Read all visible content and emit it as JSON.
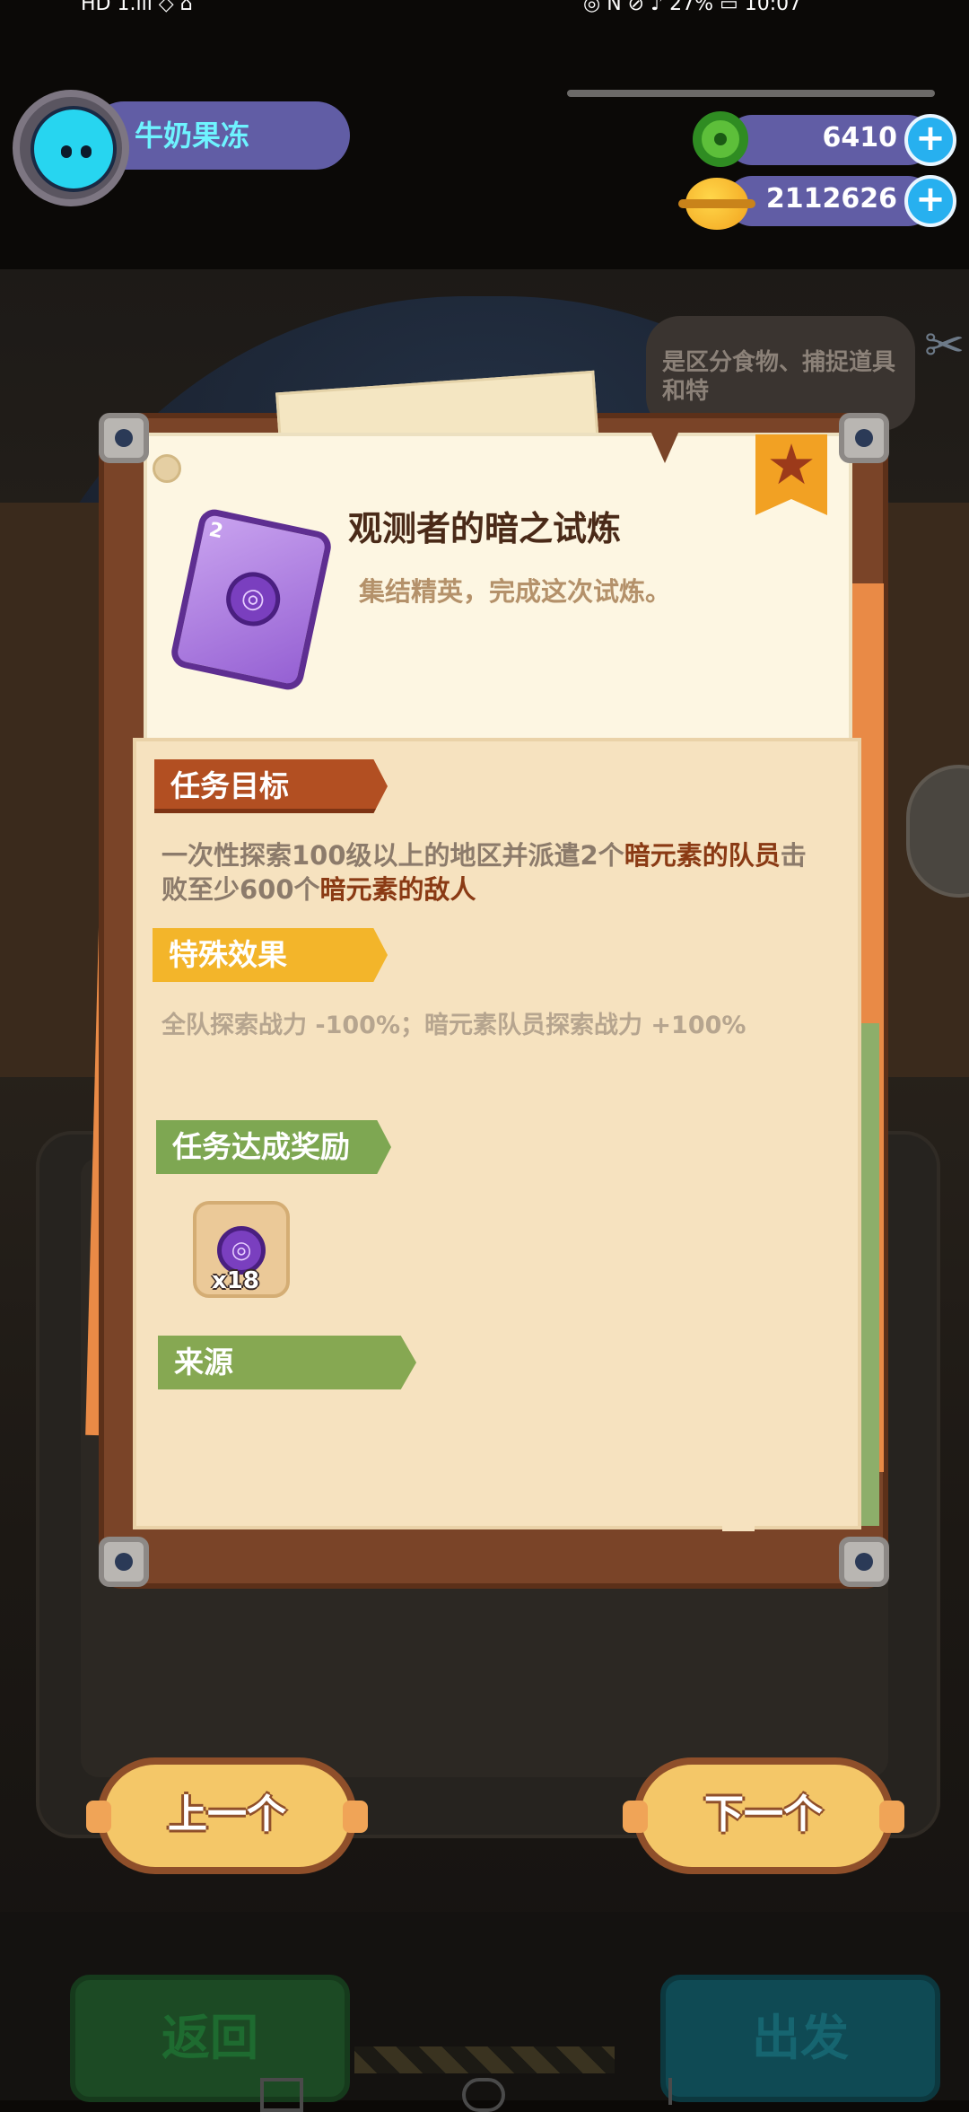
{
  "status_bar": {
    "left": "HD 1.ıll ◇ ⌂",
    "right": "◎ N ⊘ ♪ 27% ▭ 10:07"
  },
  "player": {
    "name": "牛奶果冻",
    "avatar": "cat-avatar-icon"
  },
  "currencies": [
    {
      "name": "green-donut-currency-icon",
      "value": "6410"
    },
    {
      "name": "gold-planet-currency-icon",
      "value": "2112626"
    }
  ],
  "hint_text": "是区分食物、捕捉道具和特",
  "quest": {
    "card_level": "2",
    "title": "观测者的暗之试炼",
    "subtitle": "集结精英，完成这次试炼。",
    "objective_label": "任务目标",
    "objective": {
      "p1": "一次性探索100级以上的地区并派遣2个",
      "h1": "暗元素的队员",
      "p2": "击败至少600个",
      "h2": "暗元素的敌人"
    },
    "effect_label": "特殊效果",
    "effect": "全队探索战力 -100%；暗元素队员探索战力 +100%",
    "reward_label": "任务达成奖励",
    "reward": {
      "icon": "purple-hex-medal-icon",
      "qty": "x18"
    },
    "source_label": "来源"
  },
  "nav": {
    "prev": "上一个",
    "next": "下一个"
  },
  "bottom": {
    "back": "返回",
    "go": "出发"
  },
  "colors": {
    "ribbon_brown": "#b24f22",
    "ribbon_yellow": "#f3b52a",
    "ribbon_green": "#7ea752",
    "highlight": "#8a3a14"
  }
}
